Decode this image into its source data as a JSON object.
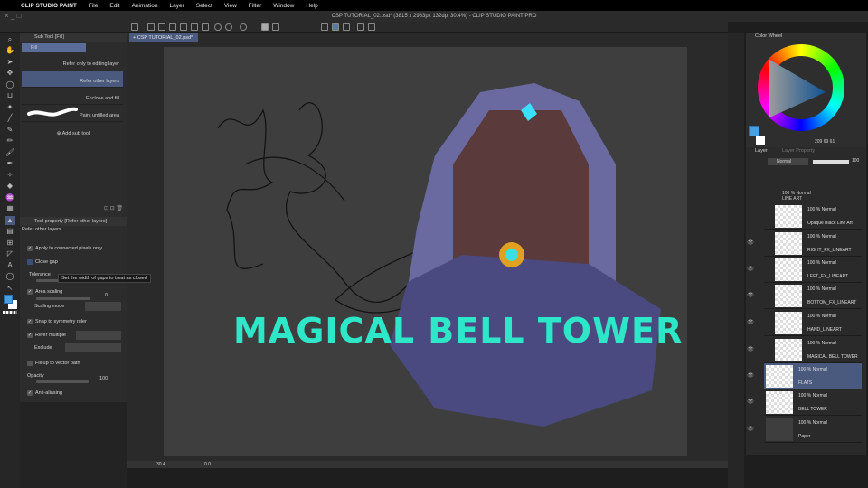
{
  "menubar": {
    "apple": "",
    "app": "CLIP STUDIO PAINT",
    "items": [
      "File",
      "Edit",
      "Animation",
      "Layer",
      "Select",
      "View",
      "Filter",
      "Window",
      "Help"
    ]
  },
  "window": {
    "title": "CSP TUTORIAL_02.psd* (3815 x 2983px 132dpi 30.4%) - CLIP STUDIO PAINT PRO",
    "tab": "CSP TUTORIAL_02.psd*"
  },
  "subtool": {
    "header": "Sub Tool [Fill]",
    "group": "Fill",
    "items": [
      "Refer only to editing layer",
      "Refer other layers",
      "Enclose and fill",
      "Paint unfilled area"
    ],
    "add": "Add sub tool"
  },
  "toolprop": {
    "header": "Tool property [Refer other layers]",
    "name": "Refer other layers",
    "apply_connected": "Apply to connected pixels only",
    "close_gap": "Close gap",
    "tolerance": "Tolerance",
    "area_scaling": "Area scaling",
    "area_value": "0",
    "scaling_mode": "Scaling mode",
    "snap": "Snap to symmetry ruler",
    "refer_multiple": "Refer multiple",
    "exclude": "Exclude",
    "fill_vector": "Fill up to vector path",
    "opacity": "Opacity",
    "opacity_value": "100",
    "antialias": "Anti-aliasing"
  },
  "tooltip": "Set the width of gaps to treat as closed",
  "canvas": {
    "title_text": "MAGICAL BELL TOWER",
    "title_color": "#2ee6c8"
  },
  "status": {
    "zoom": "30.4",
    "angle": "0.0"
  },
  "color": {
    "panel": "Color Wheel",
    "readout": "209 69 61",
    "main": "#4a9fe0"
  },
  "layers": {
    "tab": "Layer",
    "tab2": "Layer Property",
    "blend": "Normal",
    "opacity": "100",
    "group": {
      "mode": "100 % Normal",
      "name": "LINE ART"
    },
    "items": [
      {
        "mode": "100 % Normal",
        "name": "Opaque Black Line Art"
      },
      {
        "mode": "100 % Normal",
        "name": "RIGHT_FX_LINEART"
      },
      {
        "mode": "100 % Normal",
        "name": "LEFT_FX_LINEART"
      },
      {
        "mode": "100 % Normal",
        "name": "BOTTOM_FX_LINEART"
      },
      {
        "mode": "100 % Normal",
        "name": "HAND_LINEART"
      },
      {
        "mode": "100 % Normal",
        "name": "MAGICAL BELL TOWER"
      },
      {
        "mode": "100 % Normal",
        "name": "FLATS"
      },
      {
        "mode": "100 % Normal",
        "name": "BELL TOWER"
      },
      {
        "mode": "100 % Normal",
        "name": "Paper"
      }
    ]
  }
}
